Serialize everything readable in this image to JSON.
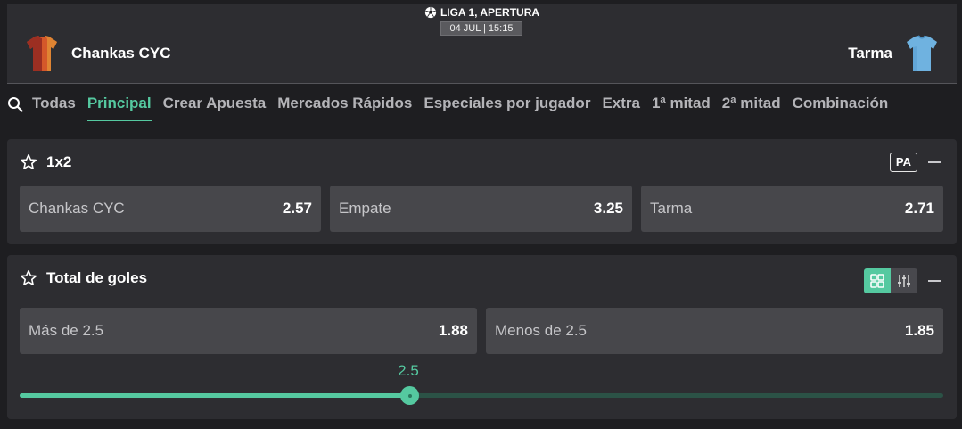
{
  "match": {
    "league": "LIGA 1, APERTURA",
    "date": "04 JUL | 15:15",
    "home_team": "Chankas CYC",
    "away_team": "Tarma"
  },
  "tabs": [
    {
      "label": "Todas"
    },
    {
      "label": "Principal"
    },
    {
      "label": "Crear Apuesta"
    },
    {
      "label": "Mercados Rápidos"
    },
    {
      "label": "Especiales por jugador"
    },
    {
      "label": "Extra"
    },
    {
      "label": "1ª mitad"
    },
    {
      "label": "2ª mitad"
    },
    {
      "label": "Combinación"
    }
  ],
  "active_tab": "Principal",
  "market_1x2": {
    "title": "1x2",
    "badge": "PA",
    "outcomes": [
      {
        "label": "Chankas CYC",
        "odds": "2.57"
      },
      {
        "label": "Empate",
        "odds": "3.25"
      },
      {
        "label": "Tarma",
        "odds": "2.71"
      }
    ]
  },
  "market_goals": {
    "title": "Total de goles",
    "outcomes": [
      {
        "label": "Más de 2.5",
        "odds": "1.88"
      },
      {
        "label": "Menos de 2.5",
        "odds": "1.85"
      }
    ],
    "slider_value": "2.5",
    "slider_fraction": 0.422
  },
  "colors": {
    "accent": "#55c9a0",
    "panel": "#2d2d31",
    "odd_button": "#47474b",
    "background": "#1e1e21",
    "home_jersey": "#d4582a",
    "away_jersey": "#6fb2e0"
  }
}
